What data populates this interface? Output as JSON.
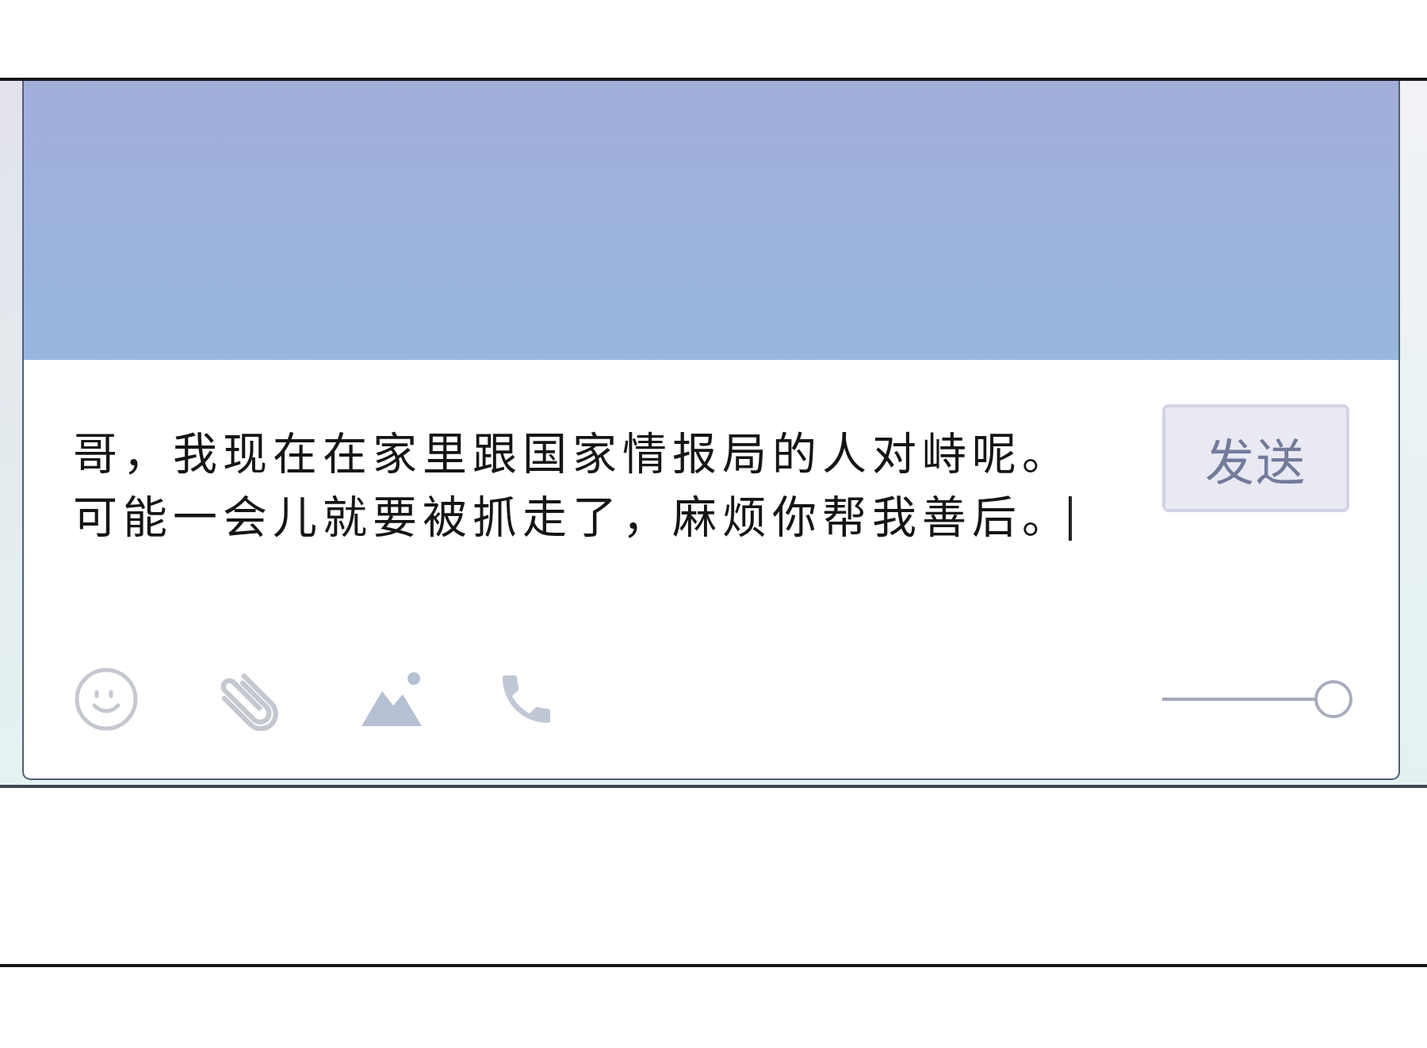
{
  "composer": {
    "message": {
      "lines": [
        "哥，我现在在家里跟国家情报局的人对峙呢。",
        "可能一会儿就要被抓走了，麻烦你帮我善后。"
      ],
      "focused": true
    },
    "send_button": {
      "label": "发送"
    },
    "toolbar": [
      {
        "kind": "emoji"
      },
      {
        "kind": "attachment"
      },
      {
        "kind": "image"
      },
      {
        "kind": "call"
      }
    ],
    "slider": {
      "level": 1
    }
  }
}
